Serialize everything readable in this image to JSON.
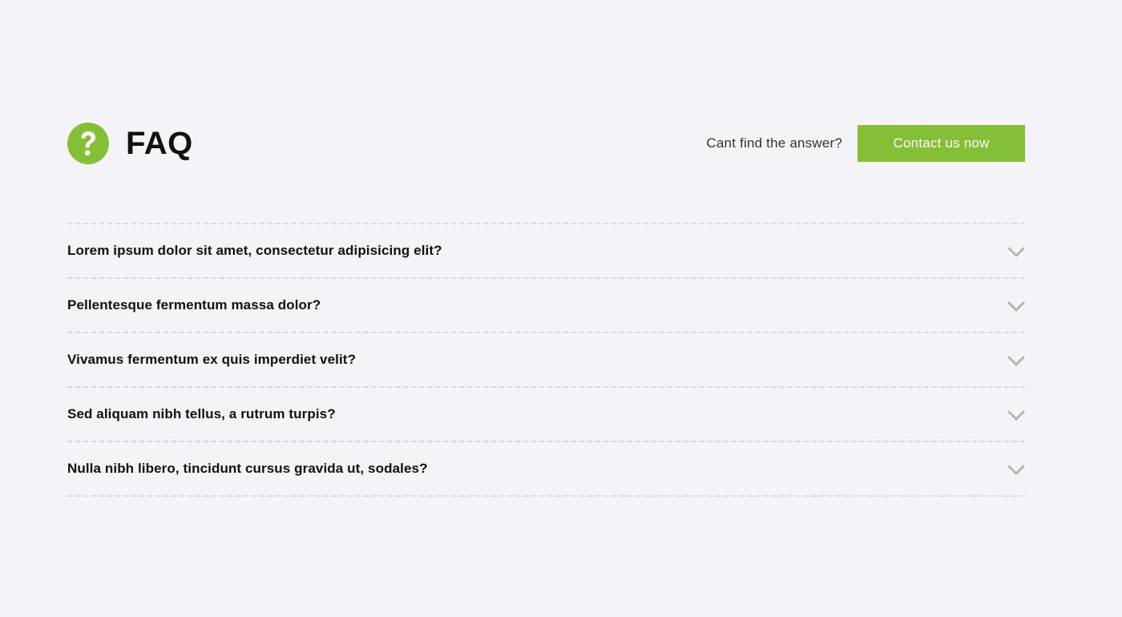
{
  "header": {
    "title": "FAQ",
    "cta_text": "Cant find the answer?",
    "contact_label": "Contact us now"
  },
  "faq": {
    "items": [
      {
        "question": "Lorem ipsum dolor sit amet, consectetur adipisicing elit?"
      },
      {
        "question": "Pellentesque fermentum massa dolor?"
      },
      {
        "question": "Vivamus fermentum ex quis imperdiet velit?"
      },
      {
        "question": "Sed aliquam nibh tellus, a rutrum turpis?"
      },
      {
        "question": "Nulla nibh libero, tincidunt cursus gravida ut, sodales?"
      }
    ]
  },
  "icons": {
    "title_icon": "question-circle-icon",
    "item_icon": "chevron-down-icon"
  },
  "colors": {
    "accent": "#84bf37",
    "background": "#f4f4f8",
    "divider": "#d6d6dc",
    "chevron": "#b5b5b5",
    "text": "#111111"
  }
}
